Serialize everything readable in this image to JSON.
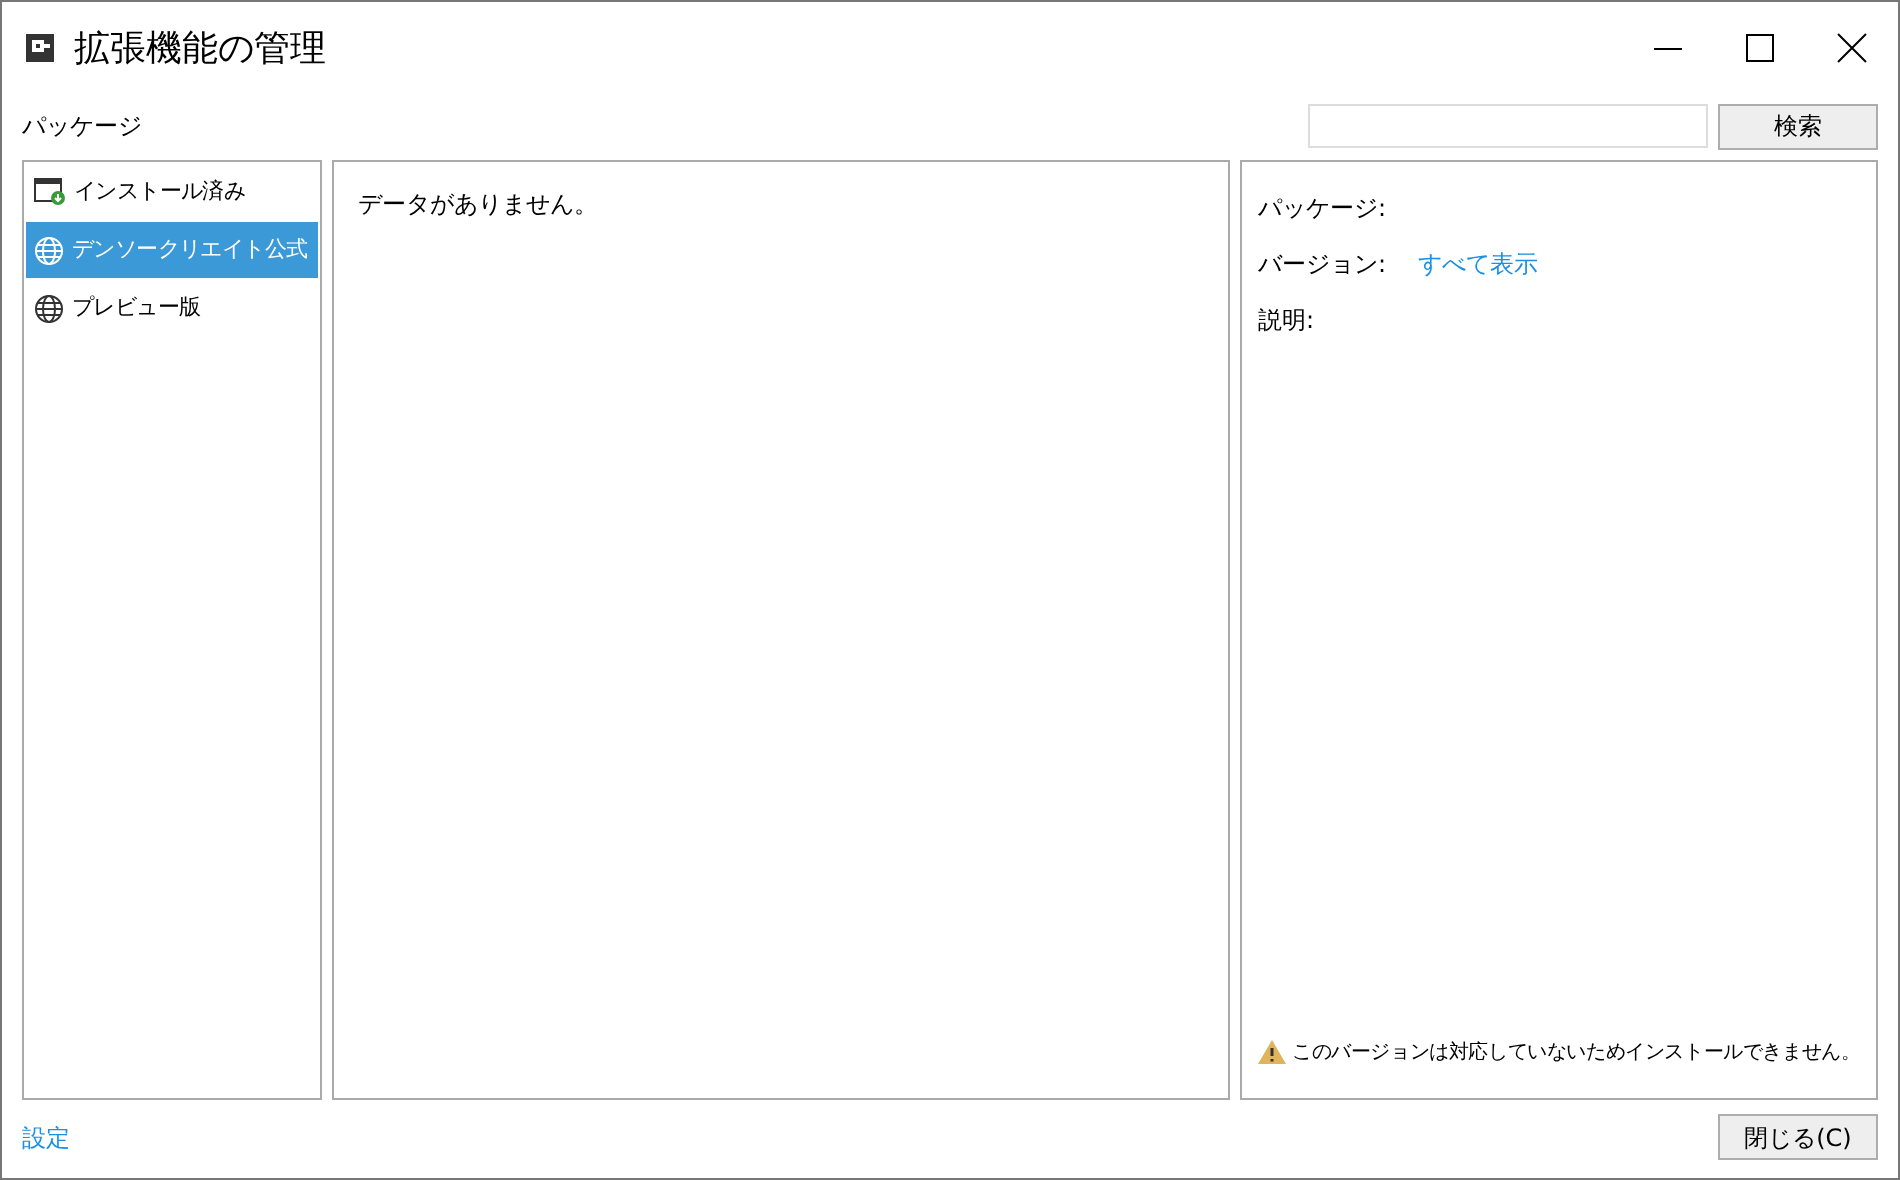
{
  "window": {
    "title": "拡張機能の管理"
  },
  "packages_label": "パッケージ",
  "search": {
    "button": "検索"
  },
  "sidebar": {
    "items": [
      {
        "label": "インストール済み",
        "kind": "installed",
        "selected": false
      },
      {
        "label": "デンソークリエイト公式",
        "kind": "globe",
        "selected": true
      },
      {
        "label": "プレビュー版",
        "kind": "globe",
        "selected": false
      }
    ]
  },
  "list": {
    "empty_message": "データがありません。"
  },
  "details": {
    "package_label": "パッケージ:",
    "version_label": "バージョン:",
    "version_link": "すべて表示",
    "description_label": "説明:",
    "warning": "このバージョンは対応していないためインストールできません。"
  },
  "footer": {
    "settings_link": "設定",
    "close_button": "閉じる(C)"
  }
}
